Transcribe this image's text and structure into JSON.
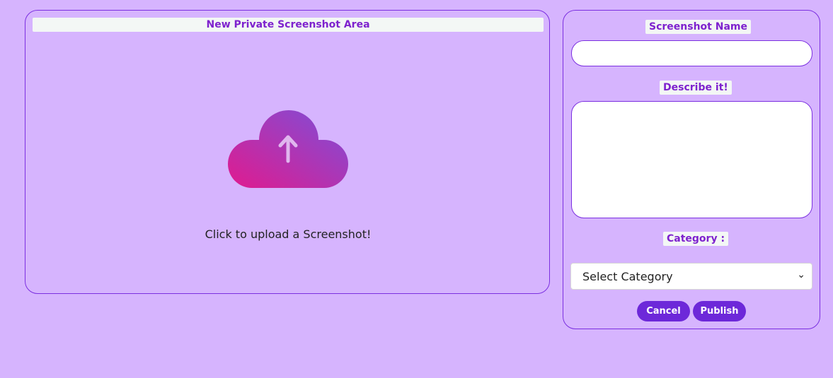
{
  "upload_area": {
    "title": "New Private Screenshot Area",
    "upload_prompt": "Click to upload a Screenshot!",
    "icon": "cloud-upload-icon"
  },
  "form": {
    "name_label": "Screenshot Name",
    "name_value": "",
    "description_label": "Describe it!",
    "description_value": "",
    "category_label": "Category :",
    "category_selected": "Select Category",
    "cancel_label": "Cancel",
    "publish_label": "Publish"
  },
  "colors": {
    "background": "#d6b4fe",
    "accent": "#6d28d9",
    "label_text": "#7e22ce",
    "gradient_start": "#e01b8f",
    "gradient_end": "#7c4fd9"
  }
}
